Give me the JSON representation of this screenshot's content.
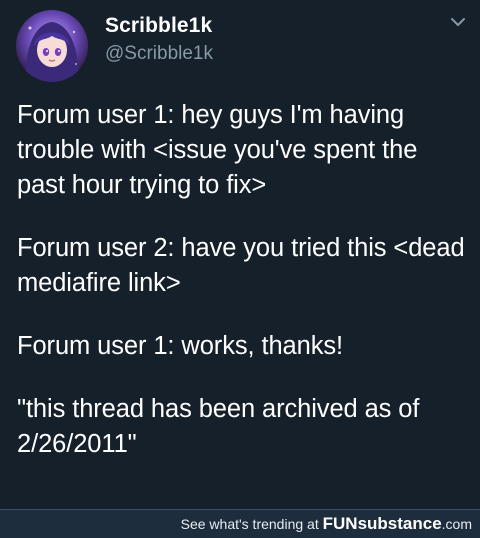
{
  "tweet": {
    "author": {
      "display_name": "Scribble1k",
      "handle": "@Scribble1k"
    },
    "paragraphs": [
      "Forum user 1: hey guys I'm having trouble with <issue you've spent the past hour trying to fix>",
      "Forum user 2: have you tried this <dead mediafire link>",
      "Forum user 1: works,  thanks!",
      "\"this thread has been archived as of 2/26/2011\""
    ]
  },
  "footer": {
    "prefix": "See what's trending at ",
    "brand_fun": "FUN",
    "brand_sub": "substance",
    "brand_domain": ".com"
  },
  "colors": {
    "background": "#15202b",
    "text": "#ffffff",
    "handle": "#8899a6",
    "footer_bg": "#1e2d3d"
  },
  "icons": {
    "avatar": "anime-avatar",
    "menu": "chevron-down-icon"
  }
}
